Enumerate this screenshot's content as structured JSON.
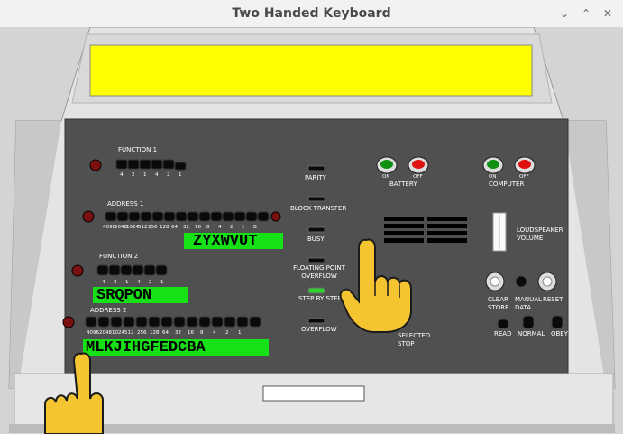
{
  "window": {
    "title": "Two Handed Keyboard",
    "minimize_glyph": "⌄",
    "maximize_glyph": "⌃",
    "close_glyph": "✕"
  },
  "function1": {
    "label": "FUNCTION 1",
    "bits": [
      "4",
      "2",
      "1",
      "4",
      "2",
      "1"
    ]
  },
  "address1": {
    "label": "ADDRESS 1",
    "bits": [
      "4096",
      "2048",
      "1024",
      "512",
      "256",
      "128",
      "64",
      "32",
      "16",
      "8",
      "4",
      "2",
      "1",
      "B"
    ],
    "letters": "ZYXWVUT"
  },
  "function2": {
    "label": "FUNCTION 2",
    "bits": [
      "4",
      "2",
      "1",
      "4",
      "2",
      "1"
    ],
    "letters": "SRQPON"
  },
  "address2": {
    "label": "ADDRESS 2",
    "bits": [
      "4096",
      "2048",
      "1024",
      "512",
      "256",
      "128",
      "64",
      "32",
      "16",
      "8",
      "4",
      "2",
      "1"
    ],
    "letters": "MLKJIHGFEDCBA"
  },
  "indicators": {
    "parity": "PARITY",
    "block_transfer": "BLOCK TRANSFER",
    "busy": "BUSY",
    "floating_point_overflow": "FLOATING POINT OVERFLOW",
    "step_by_step": "STEP BY STEP",
    "overflow": "OVERFLOW"
  },
  "battery": {
    "label": "BATTERY",
    "on": "ON",
    "off": "OFF"
  },
  "computer": {
    "label": "COMPUTER",
    "on": "ON",
    "off": "OFF"
  },
  "loudspeaker": "LOUDSPEAKER VOLUME",
  "buttons": {
    "clear_store": "CLEAR STORE",
    "manual_data": "MANUAL DATA",
    "reset": "RESET",
    "read": "READ",
    "normal": "NORMAL",
    "obey": "OBEY",
    "selected_stop": "SELECTED STOP"
  },
  "colors": {
    "panel": "#505050",
    "bezel": "#e6e6e6",
    "display": "#ffff00",
    "led_green": "#16e016",
    "lamp_red": "#7a1010",
    "key_black": "#0a0a0a"
  },
  "icons": [
    "pointing-hand-icon"
  ]
}
